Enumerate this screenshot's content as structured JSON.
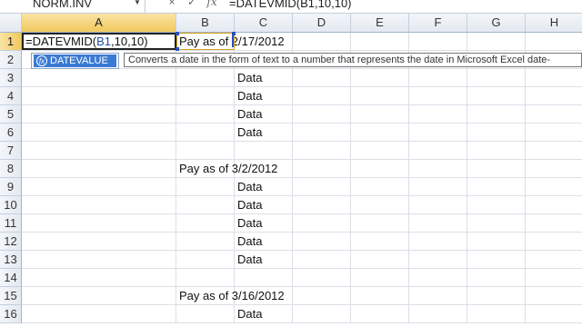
{
  "formula_bar": {
    "name_box": "NORM.INV",
    "cancel_icon": "×",
    "enter_icon": "✓",
    "fx_label": "fx",
    "formula": "=DATEVMID(B1,10,10)"
  },
  "columns": [
    "A",
    "B",
    "C",
    "D",
    "E",
    "F",
    "G",
    "H"
  ],
  "active_column": "A",
  "active_row": "1",
  "rows": [
    {
      "num": "1",
      "A": "",
      "B": "Pay as of 2/17/2012",
      "C": ""
    },
    {
      "num": "2",
      "A": "",
      "B": "",
      "C": ""
    },
    {
      "num": "3",
      "A": "",
      "B": "",
      "C": "Data"
    },
    {
      "num": "4",
      "A": "",
      "B": "",
      "C": "Data"
    },
    {
      "num": "5",
      "A": "",
      "B": "",
      "C": "Data"
    },
    {
      "num": "6",
      "A": "",
      "B": "",
      "C": "Data"
    },
    {
      "num": "7",
      "A": "",
      "B": "",
      "C": ""
    },
    {
      "num": "8",
      "A": "",
      "B": "Pay as of 3/2/2012",
      "C": ""
    },
    {
      "num": "9",
      "A": "",
      "B": "",
      "C": "Data"
    },
    {
      "num": "10",
      "A": "",
      "B": "",
      "C": "Data"
    },
    {
      "num": "11",
      "A": "",
      "B": "",
      "C": "Data"
    },
    {
      "num": "12",
      "A": "",
      "B": "",
      "C": "Data"
    },
    {
      "num": "13",
      "A": "",
      "B": "",
      "C": "Data"
    },
    {
      "num": "14",
      "A": "",
      "B": "",
      "C": ""
    },
    {
      "num": "15",
      "A": "",
      "B": "Pay as of 3/16/2012",
      "C": ""
    },
    {
      "num": "16",
      "A": "",
      "B": "",
      "C": "Data"
    }
  ],
  "editing_cell": {
    "prefix": "=DATEV",
    "func_rest": "MID(",
    "ref": "B1",
    "suffix": ",10,10)"
  },
  "autocomplete": {
    "item": "DATEVALUE",
    "icon": "fx-function-icon"
  },
  "tooltip": "Converts a date in the form of text to a number that represents the date in Microsoft Excel date-",
  "colors": {
    "active_header": "#f1c95b",
    "autocomplete_highlight": "#3b7ad4",
    "reference": "#1d4fa8"
  }
}
